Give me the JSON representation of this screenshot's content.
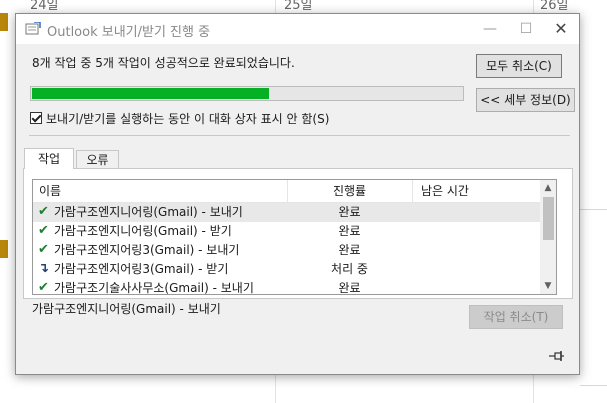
{
  "calendar": {
    "dates": [
      "24일",
      "25일",
      "26일"
    ]
  },
  "dialog": {
    "title": "Outlook 보내기/받기 진행 중",
    "status_text": "8개 작업 중 5개 작업이 성공적으로 완료되었습니다.",
    "progress_fraction": 0.55,
    "buttons": {
      "cancel_all": "모두 취소(C)",
      "details": "<< 세부 정보(D)",
      "cancel_task": "작업 취소(T)"
    },
    "checkbox_label": "보내기/받기를 실행하는 동안 이 대화 상자 표시 안 함(S)",
    "checkbox_checked": true,
    "tabs": [
      {
        "label": "작업",
        "active": true
      },
      {
        "label": "오류",
        "active": false
      }
    ],
    "columns": [
      "이름",
      "진행률",
      "남은 시간"
    ],
    "rows": [
      {
        "status_icon": "check-icon",
        "name": "가람구조엔지니어링(Gmail) - 보내기",
        "progress": "완료",
        "remaining": "",
        "selected": true
      },
      {
        "status_icon": "check-icon",
        "name": "가람구조엔지니어링(Gmail) - 받기",
        "progress": "완료",
        "remaining": "",
        "selected": false
      },
      {
        "status_icon": "check-icon",
        "name": "가람구조엔지어링3(Gmail) - 보내기",
        "progress": "완료",
        "remaining": "",
        "selected": false
      },
      {
        "status_icon": "processing-arrow-icon",
        "name": "가람구조엔지어링3(Gmail) - 받기",
        "progress": "처리 중",
        "remaining": "",
        "selected": false
      },
      {
        "status_icon": "check-icon",
        "name": "가람구조기술사사무소(Gmail) - 보내기",
        "progress": "완료",
        "remaining": "",
        "selected": false
      }
    ],
    "current_task": "가람구조엔지니어링(Gmail) - 보내기",
    "colors": {
      "progress_fill": "#06b025",
      "check": "#1e7e2e",
      "processing": "#22407a"
    }
  }
}
